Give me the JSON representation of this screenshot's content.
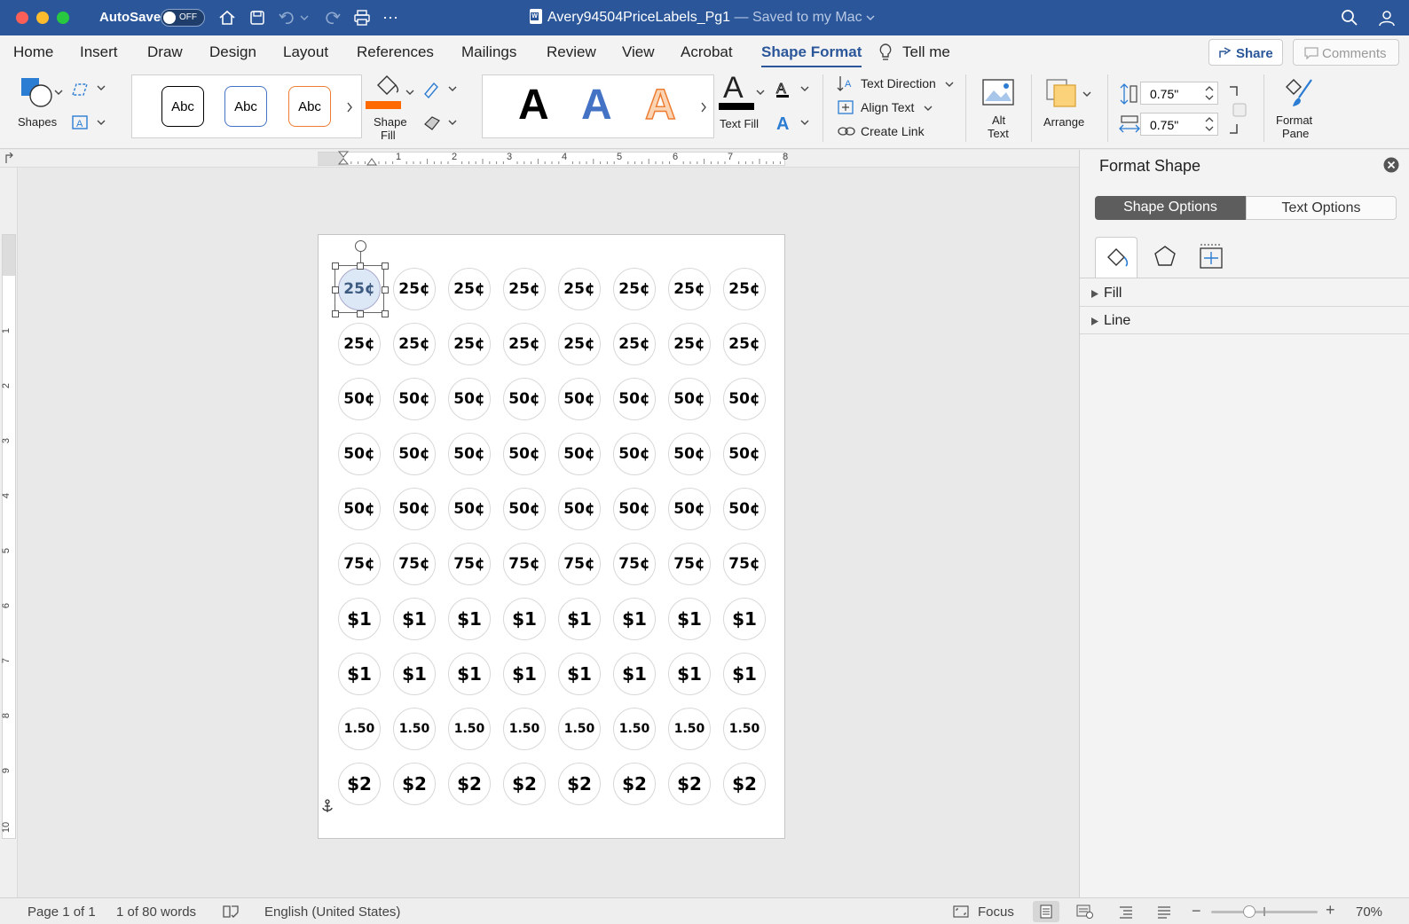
{
  "title": {
    "autosave": "AutoSave",
    "toggle": "OFF",
    "doc_name": "Avery94504PriceLabels_Pg1",
    "saved": " — Saved to my Mac"
  },
  "menu": {
    "tabs": [
      "Home",
      "Insert",
      "Draw",
      "Design",
      "Layout",
      "References",
      "Mailings",
      "Review",
      "View",
      "Acrobat",
      "Shape Format"
    ],
    "active": "Shape Format",
    "tellme": "Tell me",
    "share": "Share",
    "comments": "Comments"
  },
  "ribbon": {
    "shapes": "Shapes",
    "abc": "Abc",
    "shape_fill_1": "Shape",
    "shape_fill_2": "Fill",
    "wordart": "A",
    "text_fill": "Text Fill",
    "text_direction": "Text Direction",
    "align_text": "Align Text",
    "create_link": "Create Link",
    "alt_text_1": "Alt",
    "alt_text_2": "Text",
    "arrange": "Arrange",
    "height": "0.75\"",
    "width": "0.75\"",
    "format_pane_1": "Format",
    "format_pane_2": "Pane",
    "fill_color": "#ff6a00"
  },
  "ruler": {
    "h": [
      "1",
      "2",
      "3",
      "4",
      "5",
      "6",
      "7",
      "8"
    ],
    "v": [
      "1",
      "2",
      "3",
      "4",
      "5",
      "6",
      "7",
      "8",
      "9",
      "10"
    ]
  },
  "labels": {
    "rows": [
      "25¢",
      "25¢",
      "50¢",
      "50¢",
      "50¢",
      "75¢",
      "$1",
      "$1",
      "1.50",
      "$2"
    ],
    "per_row": 8
  },
  "pane": {
    "title": "Format Shape",
    "shape_options": "Shape Options",
    "text_options": "Text Options",
    "fill": "Fill",
    "line": "Line"
  },
  "status": {
    "page": "Page 1 of 1",
    "words": "1 of 80 words",
    "language": "English (United States)",
    "focus": "Focus",
    "zoom": "70%",
    "zoom_level": 0.7
  }
}
